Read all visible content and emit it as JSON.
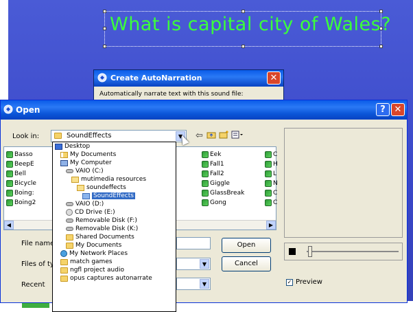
{
  "slide": {
    "question": "What is capital city of Wales?"
  },
  "auto_dialog": {
    "title": "Create AutoNarration",
    "body": "Automatically narrate text with this sound file:"
  },
  "open_dialog": {
    "title": "Open",
    "look_in_label": "Look in:",
    "look_in_value": "SoundEffects",
    "file_columns": [
      [
        "Basso",
        "BeepE",
        "Bell",
        "Bicycle",
        "Boing:",
        "Boing2"
      ],
      [
        "Eek",
        "Fall1",
        "Fall2",
        "Giggle",
        "GlassBreak",
        "Gong"
      ],
      [
        "C",
        "H",
        "L",
        "N",
        "C",
        "C"
      ]
    ],
    "file_name_label": "File name",
    "files_of_type_label": "Files of typ",
    "recent_label": "Recent",
    "open_button": "Open",
    "cancel_button": "Cancel",
    "preview_label": "Preview",
    "preview_checked": true
  },
  "dropdown": {
    "items": [
      {
        "label": "Desktop",
        "icon": "desktop-icon",
        "indent": 0,
        "selected": false
      },
      {
        "label": "My Documents",
        "icon": "documents-folder-icon",
        "indent": 1,
        "selected": false
      },
      {
        "label": "My Computer",
        "icon": "computer-icon",
        "indent": 1,
        "selected": false
      },
      {
        "label": "VAIO (C:)",
        "icon": "drive-icon",
        "indent": 2,
        "selected": false
      },
      {
        "label": "mutimedia resources",
        "icon": "folder-open-icon",
        "indent": 3,
        "selected": false
      },
      {
        "label": "soundeffects",
        "icon": "folder-open-icon",
        "indent": 4,
        "selected": false
      },
      {
        "label": "SoundEffects",
        "icon": "folder-icon",
        "indent": 5,
        "selected": true
      },
      {
        "label": "VAIO (D:)",
        "icon": "drive-icon",
        "indent": 2,
        "selected": false
      },
      {
        "label": "CD Drive (E:)",
        "icon": "cd-drive-icon",
        "indent": 2,
        "selected": false
      },
      {
        "label": "Removable Disk (F:)",
        "icon": "drive-icon",
        "indent": 2,
        "selected": false
      },
      {
        "label": "Removable Disk (K:)",
        "icon": "drive-icon",
        "indent": 2,
        "selected": false
      },
      {
        "label": "Shared Documents",
        "icon": "folder-icon",
        "indent": 2,
        "selected": false
      },
      {
        "label": "My Documents",
        "icon": "folder-icon",
        "indent": 2,
        "selected": false
      },
      {
        "label": "My Network Places",
        "icon": "network-icon",
        "indent": 1,
        "selected": false
      },
      {
        "label": "match games",
        "icon": "folder-icon",
        "indent": 1,
        "selected": false
      },
      {
        "label": "ngfl project audio",
        "icon": "folder-icon",
        "indent": 1,
        "selected": false
      },
      {
        "label": "opus captures autonarrate",
        "icon": "folder-icon",
        "indent": 1,
        "selected": false
      }
    ]
  }
}
